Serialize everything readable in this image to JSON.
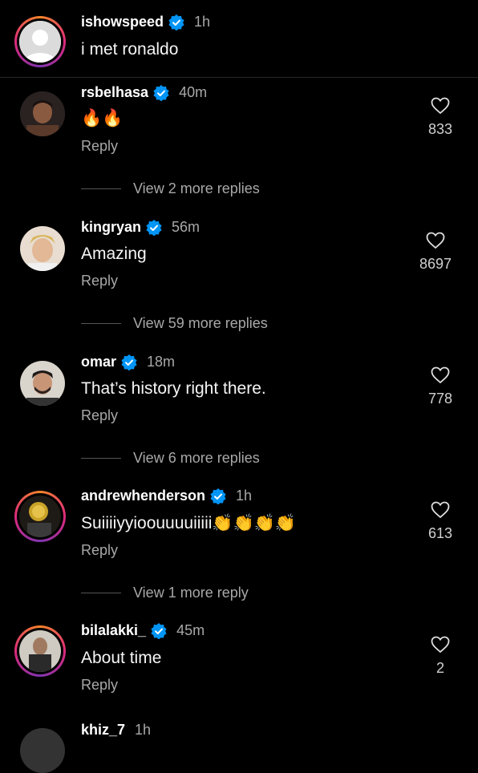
{
  "caption": {
    "username": "ishowspeed",
    "time": "1h",
    "text": "i met ronaldo"
  },
  "comments": [
    {
      "username": "rsbelhasa",
      "time": "40m",
      "text": "🔥🔥",
      "reply_label": "Reply",
      "likes": "833",
      "view_more": "View 2 more replies"
    },
    {
      "username": "kingryan",
      "time": "56m",
      "text": "Amazing",
      "reply_label": "Reply",
      "likes": "8697",
      "view_more": "View 59 more replies"
    },
    {
      "username": "omar",
      "time": "18m",
      "text": "That’s history right there.",
      "reply_label": "Reply",
      "likes": "778",
      "view_more": "View 6 more replies"
    },
    {
      "username": "andrewhenderson",
      "time": "1h",
      "text": "Suiiiiyyioouuuuiiiii👏👏👏👏",
      "reply_label": "Reply",
      "likes": "613",
      "view_more": "View 1 more reply"
    },
    {
      "username": "bilalakki_",
      "time": "45m",
      "text": "About time",
      "reply_label": "Reply",
      "likes": "2"
    },
    {
      "username": "khiz_7",
      "time": "1h"
    }
  ],
  "colors": {
    "verified": "#0095f6",
    "muted": "#a8a8a8",
    "background": "#000000"
  }
}
